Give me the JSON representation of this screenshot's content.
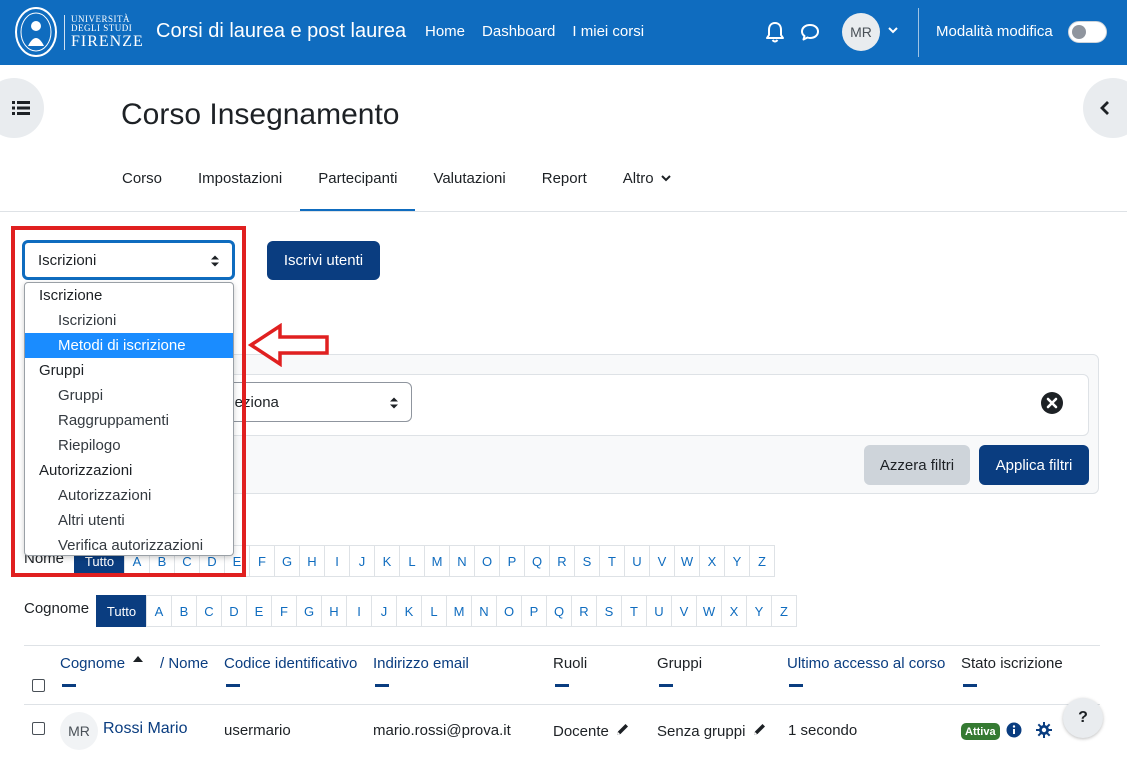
{
  "brand": {
    "university_line1": "UNIVERSITÀ",
    "university_line2": "DEGLI STUDI",
    "university_line3": "FIRENZE"
  },
  "navbar": {
    "site_title": "Corsi di laurea e post laurea",
    "links": [
      "Home",
      "Dashboard",
      "I miei corsi"
    ],
    "user_initials": "MR",
    "edit_mode_label": "Modalità modifica",
    "edit_mode_on": false
  },
  "page": {
    "title": "Corso Insegnamento"
  },
  "secondary_nav": {
    "tabs": [
      "Corso",
      "Impostazioni",
      "Partecipanti",
      "Valutazioni",
      "Report",
      "Altro"
    ],
    "active": "Partecipanti"
  },
  "toolbar": {
    "select_value": "Iscrizioni",
    "enrol_button": "Iscrivi utenti"
  },
  "dropdown": {
    "items": [
      {
        "type": "group",
        "label": "Iscrizione"
      },
      {
        "type": "option",
        "label": "Iscrizioni"
      },
      {
        "type": "option",
        "label": "Metodi di iscrizione",
        "selected": true
      },
      {
        "type": "group",
        "label": "Gruppi"
      },
      {
        "type": "option",
        "label": "Gruppi"
      },
      {
        "type": "option",
        "label": "Raggruppamenti"
      },
      {
        "type": "option",
        "label": "Riepilogo"
      },
      {
        "type": "group",
        "label": "Autorizzazioni"
      },
      {
        "type": "option",
        "label": "Autorizzazioni"
      },
      {
        "type": "option",
        "label": "Altri utenti"
      },
      {
        "type": "option",
        "label": "Verifica autorizzazioni"
      }
    ]
  },
  "filters": {
    "select_text": "eleziona",
    "reset_button": "Azzera filtri",
    "apply_button": "Applica filtri"
  },
  "initials": {
    "first_name_label": "Nome",
    "last_name_label": "Cognome",
    "all_label": "Tutto",
    "letters": [
      "A",
      "B",
      "C",
      "D",
      "E",
      "F",
      "G",
      "H",
      "I",
      "J",
      "K",
      "L",
      "M",
      "N",
      "O",
      "P",
      "Q",
      "R",
      "S",
      "T",
      "U",
      "V",
      "W",
      "X",
      "Y",
      "Z"
    ]
  },
  "table": {
    "headers": {
      "surname": "Cognome",
      "name": "/ Nome",
      "id_code": "Codice identificativo",
      "email": "Indirizzo email",
      "roles": "Ruoli",
      "groups": "Gruppi",
      "last_access": "Ultimo accesso al corso",
      "status": "Stato iscrizione"
    },
    "rows": [
      {
        "initials": "MR",
        "fullname": "Rossi Mario",
        "id_code": "usermario",
        "email": "mario.rossi@prova.it",
        "role": "Docente",
        "groups": "Senza gruppi",
        "last_access": "1 secondo",
        "status": "Attiva"
      }
    ]
  },
  "help": {
    "label": "?"
  },
  "colors": {
    "brand_blue": "#0f6cbf",
    "dark_button": "#0a3d80",
    "annotation_red": "#e02020",
    "selected_option": "#1a8cff",
    "active_badge": "#357a32"
  }
}
